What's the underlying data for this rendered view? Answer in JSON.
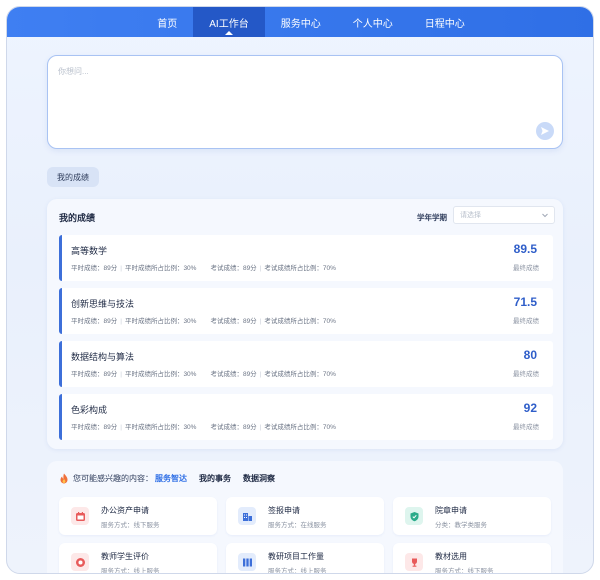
{
  "nav": {
    "items": [
      {
        "label": "首页",
        "active": false
      },
      {
        "label": "AI工作台",
        "active": true
      },
      {
        "label": "服务中心",
        "active": false
      },
      {
        "label": "个人中心",
        "active": false
      },
      {
        "label": "日程中心",
        "active": false
      }
    ]
  },
  "ask": {
    "placeholder": "你想问..."
  },
  "chip": {
    "label": "我的成绩"
  },
  "grades": {
    "title": "我的成绩",
    "term_label": "学年学期",
    "term_placeholder": "请选择",
    "score_caption": "最终成绩",
    "courses": [
      {
        "name": "高等数学",
        "usual": "平时成绩：89分",
        "usual_ratio": "平时成绩所占比例：30%",
        "exam": "考试成绩：89分",
        "exam_ratio": "考试成绩所占比例：70%",
        "score": "89.5"
      },
      {
        "name": "创新思维与技法",
        "usual": "平时成绩：89分",
        "usual_ratio": "平时成绩所占比例：30%",
        "exam": "考试成绩：89分",
        "exam_ratio": "考试成绩所占比例：70%",
        "score": "71.5"
      },
      {
        "name": "数据结构与算法",
        "usual": "平时成绩：89分",
        "usual_ratio": "平时成绩所占比例：30%",
        "exam": "考试成绩：89分",
        "exam_ratio": "考试成绩所占比例：70%",
        "score": "80"
      },
      {
        "name": "色彩构成",
        "usual": "平时成绩：89分",
        "usual_ratio": "平时成绩所占比例：30%",
        "exam": "考试成绩：89分",
        "exam_ratio": "考试成绩所占比例：70%",
        "score": "92"
      }
    ]
  },
  "interest": {
    "lead": "您可能感兴趣的内容：",
    "tabs": [
      {
        "label": "服务智达",
        "active": true
      },
      {
        "label": "我的事务",
        "active": false
      },
      {
        "label": "数据洞察",
        "active": false
      }
    ],
    "services": [
      {
        "title": "办公资产申请",
        "sub": "服务方式：线下服务",
        "icon": "calendar-icon",
        "color": "#e85a5a",
        "bg": "#fde8e8"
      },
      {
        "title": "签报申请",
        "sub": "服务方式：在线服务",
        "icon": "building-icon",
        "color": "#3d6fd9",
        "bg": "#e3ecfc"
      },
      {
        "title": "院章申请",
        "sub": "分类：教学类服务",
        "icon": "shield-icon",
        "color": "#2bab8a",
        "bg": "#def5ee"
      },
      {
        "title": "教师学生评价",
        "sub": "服务方式：线上服务",
        "icon": "rating-icon",
        "color": "#e85a5a",
        "bg": "#fde8e8"
      },
      {
        "title": "教研项目工作量",
        "sub": "服务方式：线上服务",
        "icon": "grid-icon",
        "color": "#3d6fd9",
        "bg": "#e3ecfc"
      },
      {
        "title": "教材选用",
        "sub": "服务方式：线下服务",
        "icon": "trophy-icon",
        "color": "#e85a5a",
        "bg": "#fde8e8"
      }
    ]
  }
}
